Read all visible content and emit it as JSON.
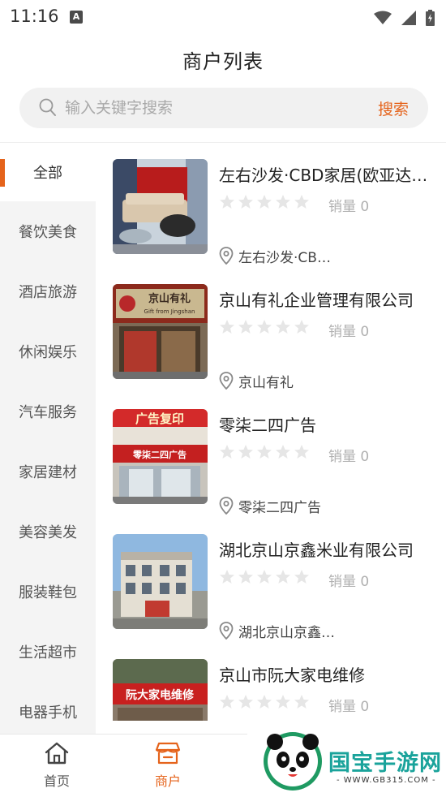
{
  "status_bar": {
    "time": "11:16",
    "notification_icon": "a-letter-icon",
    "icons": [
      "wifi-icon",
      "cell-signal-icon",
      "battery-icon"
    ]
  },
  "header": {
    "title": "商户列表"
  },
  "search": {
    "placeholder": "输入关键字搜索",
    "value": "",
    "button_label": "搜索"
  },
  "sidebar": {
    "items": [
      {
        "label": "全部",
        "active": true
      },
      {
        "label": "餐饮美食"
      },
      {
        "label": "酒店旅游"
      },
      {
        "label": "休闲娱乐"
      },
      {
        "label": "汽车服务"
      },
      {
        "label": "家居建材"
      },
      {
        "label": "美容美发"
      },
      {
        "label": "服装鞋包"
      },
      {
        "label": "生活超市"
      },
      {
        "label": "电器手机"
      }
    ]
  },
  "merchants": [
    {
      "name": "左右沙发·CBD家居(欧亚达店)",
      "rating": 0,
      "sales": "销量 0",
      "address": "左右沙发·CBD家居"
    },
    {
      "name": "京山有礼企业管理有限公司",
      "rating": 0,
      "sales": "销量 0",
      "address": "京山有礼"
    },
    {
      "name": "零柒二四广告",
      "rating": 0,
      "sales": "销量 0",
      "address": "零柒二四广告"
    },
    {
      "name": "湖北京山京鑫米业有限公司",
      "rating": 0,
      "sales": "销量 0",
      "address": "湖北京山京鑫米业"
    },
    {
      "name": "京山市阮大家电维修",
      "rating": 0,
      "sales": "销量 0",
      "address": ""
    }
  ],
  "thumb_text": {
    "sign_1": "京山有礼",
    "sign_1_sub": "Gift from Jingshan",
    "sign_2": "广告复印",
    "sign_2_sub": "零柒二四广告",
    "sign_3": "阮大家电维修"
  },
  "tabbar": {
    "tabs": [
      {
        "label": "首页",
        "icon": "home-icon",
        "active": false
      },
      {
        "label": "商户",
        "icon": "shop-icon",
        "active": true
      }
    ]
  },
  "watermark": {
    "text": "国宝手游网",
    "url": "- WWW.GB315.COM -"
  },
  "colors": {
    "accent": "#e5631b",
    "sidebar_bg": "#f4f4f4",
    "star_empty": "#e6e6e6",
    "muted": "#b0b0b0"
  }
}
